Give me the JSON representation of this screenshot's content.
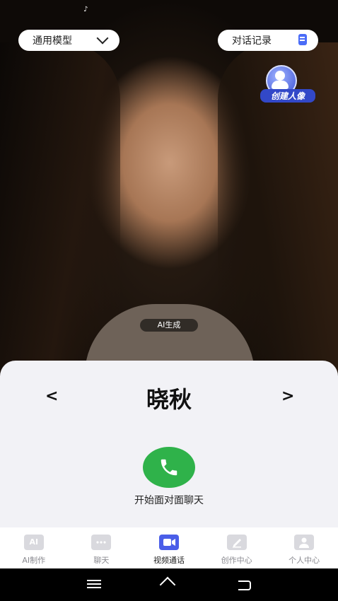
{
  "header": {
    "model_selector_label": "通用模型",
    "history_label": "对话记录",
    "create_portrait_label": "创建人像"
  },
  "photo": {
    "ai_tag": "AI生成"
  },
  "character": {
    "name": "晓秋",
    "prev_label": "<",
    "next_label": ">"
  },
  "call": {
    "label": "开始面对面聊天"
  },
  "tabs": [
    {
      "label": "AI制作",
      "icon": "ai-icon",
      "icon_text": "AI",
      "active": false
    },
    {
      "label": "聊天",
      "icon": "chat-icon",
      "icon_text": "",
      "active": false
    },
    {
      "label": "视频通话",
      "icon": "video-camera-icon",
      "icon_text": "",
      "active": true
    },
    {
      "label": "创作中心",
      "icon": "edit-icon",
      "icon_text": "",
      "active": false
    },
    {
      "label": "个人中心",
      "icon": "profile-icon",
      "icon_text": "",
      "active": false
    }
  ],
  "colors": {
    "accent": "#4a5ee8",
    "call_green": "#2fb24a",
    "panel_bg": "#f2f2f6"
  }
}
